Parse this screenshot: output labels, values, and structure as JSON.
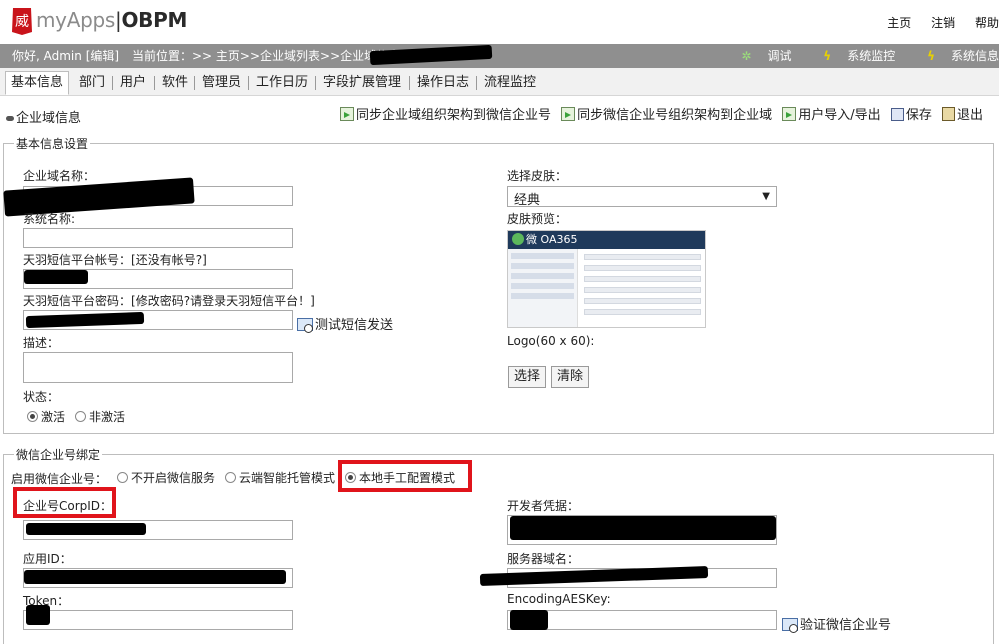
{
  "header": {
    "logo_badge_glyph": "威",
    "logo_my": "myApps",
    "logo_sep": "|",
    "logo_obpm": "OBPM",
    "links": [
      "主页",
      "注销",
      "帮助"
    ]
  },
  "greybar": {
    "user": "你好, Admin [编辑]",
    "breadcrumb": "当前位置：>> 主页>>企业域列表>>企业域信息",
    "tools": [
      {
        "label": "调试",
        "icon": "gear-icon"
      },
      {
        "label": "系统监控",
        "icon": "lightning-icon"
      },
      {
        "label": "系统信息",
        "icon": "lightning-icon"
      }
    ]
  },
  "tabs": [
    {
      "label": "基本信息",
      "active": true
    },
    {
      "label": "部门"
    },
    {
      "label": "用户"
    },
    {
      "label": "软件"
    },
    {
      "label": "管理员"
    },
    {
      "label": "工作日历"
    },
    {
      "label": "字段扩展管理"
    },
    {
      "label": "操作日志"
    },
    {
      "label": "流程监控"
    }
  ],
  "page": {
    "title": "企业域信息",
    "toolbar": {
      "sync_to_wechat": "同步企业域组织架构到微信企业号",
      "sync_from_wechat": "同步微信企业号组织架构到企业域",
      "user_import_export": "用户导入/导出",
      "save": "保存",
      "exit": "退出"
    }
  },
  "basic": {
    "legend": "基本信息设置",
    "domain_name_label": "企业域名称：",
    "system_name_label": "系统名称:",
    "sms_account_label": "天羽短信平台帐号：",
    "sms_account_link": "[还没有帐号?]",
    "sms_password_label": "天羽短信平台密码：",
    "sms_password_link": "[修改密码?请登录天羽短信平台！]",
    "test_sms": "测试短信发送",
    "description_label": "描述：",
    "status_label": "状态：",
    "status_active": "激活",
    "status_inactive": "非激活",
    "skin_label": "选择皮肤：",
    "skin_value": "经典",
    "skin_preview_label": "皮肤预览：",
    "skin_preview_brand": "微 OA365",
    "logo_label": "Logo(60 x 60):",
    "choose_button": "选择",
    "clear_button": "清除"
  },
  "wechat": {
    "legend": "微信企业号绑定",
    "enable_label": "启用微信企业号：",
    "mode_off": "不开启微信服务",
    "mode_cloud": "云端智能托管模式",
    "mode_local": "本地手工配置模式",
    "corpid_label": "企业号CorpID：",
    "developer_label": "开发者凭据：",
    "appid_label": "应用ID：",
    "server_domain_label": "服务器域名：",
    "token_label": "Token：",
    "aeskey_label": "EncodingAESKey:",
    "verify_button": "验证微信企业号"
  },
  "colors": {
    "annotation_red": "#e0141b",
    "greybar": "#8f8f8f"
  }
}
